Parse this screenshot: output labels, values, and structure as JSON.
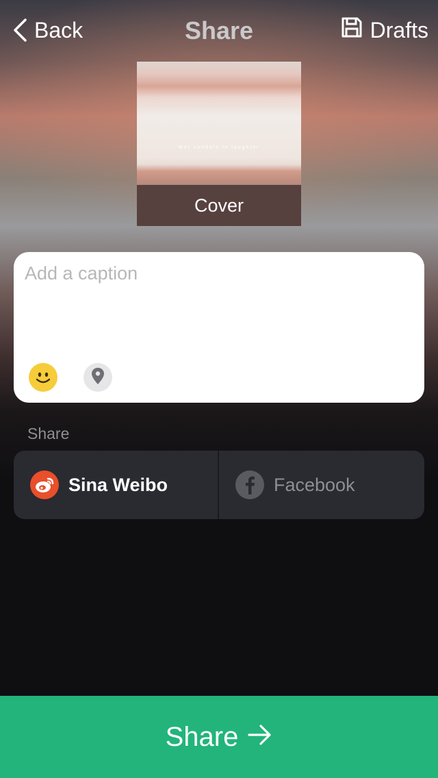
{
  "header": {
    "back_label": "Back",
    "title": "Share",
    "drafts_label": "Drafts"
  },
  "cover": {
    "label": "Cover",
    "image_text": "Wet sandals in laughter"
  },
  "caption": {
    "placeholder": "Add a caption",
    "value": ""
  },
  "share_section": {
    "label": "Share",
    "options": [
      {
        "name": "Sina Weibo",
        "icon": "weibo-icon",
        "selected": true,
        "color": "#e84f2a"
      },
      {
        "name": "Facebook",
        "icon": "facebook-icon",
        "selected": false,
        "color": "#5a5a61"
      }
    ]
  },
  "share_button": {
    "label": "Share",
    "color": "#22b47b"
  },
  "icons": {
    "back": "chevron-left-icon",
    "drafts": "save-icon",
    "emoji": "smiley-icon",
    "location": "location-pin-icon",
    "arrow": "arrow-right-icon"
  }
}
